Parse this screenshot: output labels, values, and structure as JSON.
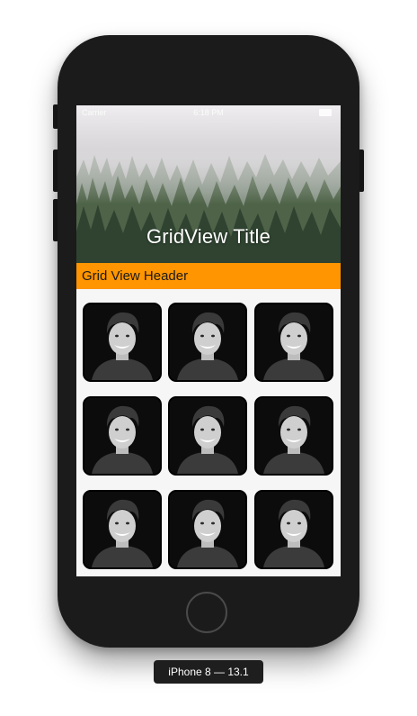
{
  "status_bar": {
    "carrier": "Carrier",
    "time": "6:18 PM"
  },
  "hero": {
    "title": "GridView Title"
  },
  "grid_header": {
    "label": "Grid View Header",
    "color": "#ff9500"
  },
  "grid": {
    "columns": 3,
    "rows": 3,
    "items": [
      {
        "image": "portrait-photo"
      },
      {
        "image": "portrait-photo"
      },
      {
        "image": "portrait-photo"
      },
      {
        "image": "portrait-photo"
      },
      {
        "image": "portrait-photo"
      },
      {
        "image": "portrait-photo"
      },
      {
        "image": "portrait-photo"
      },
      {
        "image": "portrait-photo"
      },
      {
        "image": "portrait-photo"
      }
    ]
  },
  "device": {
    "label": "iPhone 8 — 13.1"
  }
}
